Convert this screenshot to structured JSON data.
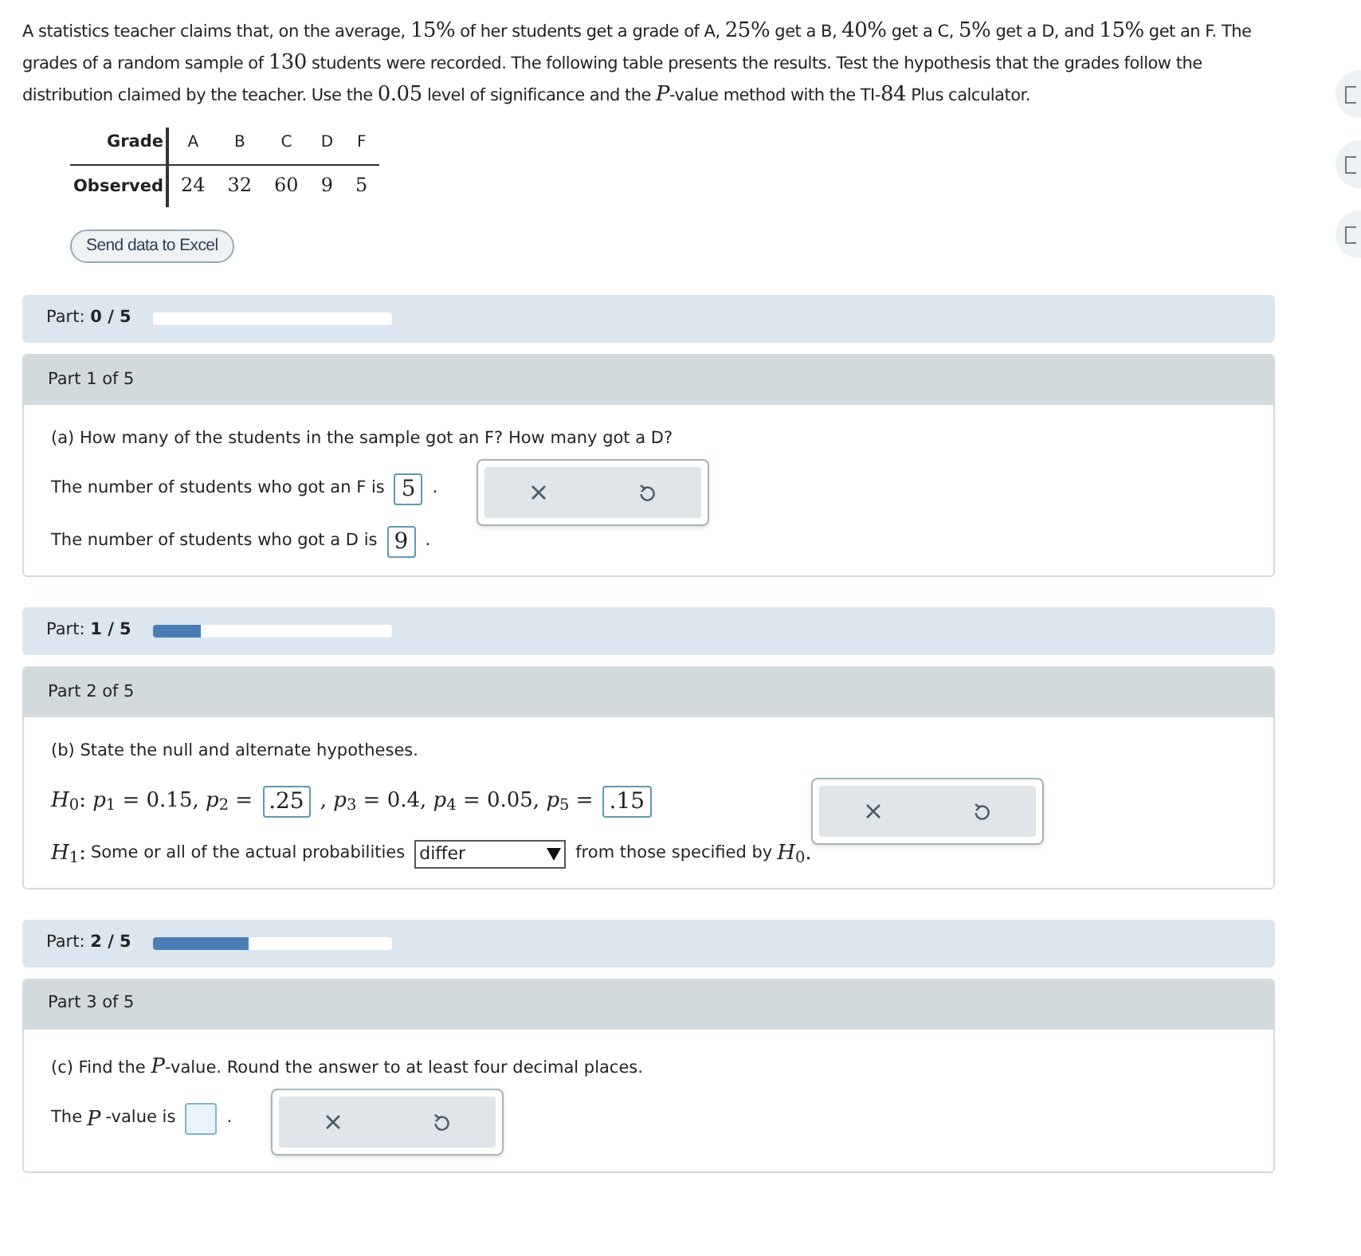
{
  "intro": [
    {
      "kind": "text",
      "s": "A statistics teacher claims that, on the average, "
    },
    {
      "kind": "math",
      "s": "15%"
    },
    {
      "kind": "text",
      "s": " of her students get a grade of A, "
    },
    {
      "kind": "math",
      "s": "25%"
    },
    {
      "kind": "text",
      "s": " get a B, "
    },
    {
      "kind": "math",
      "s": "40%"
    },
    {
      "kind": "text",
      "s": " get a C, "
    },
    {
      "kind": "math",
      "s": "5%"
    },
    {
      "kind": "text",
      "s": " get a D, and "
    },
    {
      "kind": "math",
      "s": "15%"
    },
    {
      "kind": "text",
      "s": " get an F. The grades of a random sample of "
    },
    {
      "kind": "math",
      "s": "130"
    },
    {
      "kind": "text",
      "s": " students were recorded. The following table presents the results. Test the hypothesis that the grades follow the distribution claimed by the teacher. Use the "
    },
    {
      "kind": "math",
      "s": "0.05"
    },
    {
      "kind": "text",
      "s": " level of significance and the "
    },
    {
      "kind": "math",
      "s": "*P*"
    },
    {
      "kind": "text",
      "s": "-value method with the TI-"
    },
    {
      "kind": "math",
      "s": "84"
    },
    {
      "kind": "text",
      "s": " Plus calculator."
    }
  ],
  "table": {
    "row_headers": [
      "Grade",
      "Observed"
    ],
    "rows": [
      [
        "A",
        "B",
        "C",
        "D",
        "F"
      ],
      [
        "24",
        "32",
        "60",
        "9",
        "5"
      ]
    ]
  },
  "excel_button": "Send data to Excel",
  "sections": [
    {
      "progress": {
        "label": "Part:",
        "value": "0 / 5",
        "level": 0
      },
      "title": "Part 1 of 5",
      "question": [
        {
          "kind": "text",
          "s": "(a) How many of the students in the sample got an F? How many got a D?"
        }
      ],
      "lines": [
        [
          {
            "kind": "text",
            "s": "The number of students who got an F is"
          },
          {
            "kind": "field",
            "s": "5"
          },
          {
            "kind": "text",
            "s": "."
          }
        ],
        [
          {
            "kind": "text",
            "s": "The number of students who got a D is"
          },
          {
            "kind": "field",
            "s": "9"
          },
          {
            "kind": "text",
            "s": "."
          }
        ]
      ],
      "tools_beside_line": true
    },
    {
      "progress": {
        "label": "Part:",
        "value": "1 / 5",
        "level": 0.2
      },
      "title": "Part 2 of 5",
      "question": [
        {
          "kind": "text",
          "s": "(b) State the null and alternate hypotheses."
        }
      ],
      "lines": [
        [
          {
            "kind": "math",
            "s": "*H*$_{0}$: *p*$_{1}$ = 0.15, *p*$_{2}$ ="
          },
          {
            "kind": "field",
            "s": ".25"
          },
          {
            "kind": "math",
            "s": ", *p*$_{3}$ = 0.4, *p*$_{4}$ = 0.05, *p*$_{5}$ ="
          },
          {
            "kind": "field",
            "s": ".15"
          }
        ],
        [
          {
            "kind": "math",
            "s": "*H*$_{1}$:"
          },
          {
            "kind": "text",
            "s": "Some or all of the actual probabilities"
          },
          {
            "kind": "select",
            "s": "differ"
          },
          {
            "kind": "text",
            "s": "from those specified by"
          },
          {
            "kind": "math",
            "s": "*H*$_{0}$."
          }
        ]
      ],
      "tools_beside_line": false
    },
    {
      "progress": {
        "label": "Part:",
        "value": "2 / 5",
        "level": 0.4
      },
      "title": "Part 3 of 5",
      "question": [
        {
          "kind": "text",
          "s": "(c) Find the "
        },
        {
          "kind": "math",
          "s": "*P*"
        },
        {
          "kind": "text",
          "s": "-value. Round the answer to at least four decimal places."
        }
      ],
      "lines": [
        [
          {
            "kind": "text",
            "s": "The"
          },
          {
            "kind": "math",
            "s": "*P*"
          },
          {
            "kind": "text",
            "s": "-value is"
          },
          {
            "kind": "field"
          },
          {
            "kind": "text",
            "s": "."
          }
        ]
      ],
      "tools_beside_line": true
    }
  ]
}
